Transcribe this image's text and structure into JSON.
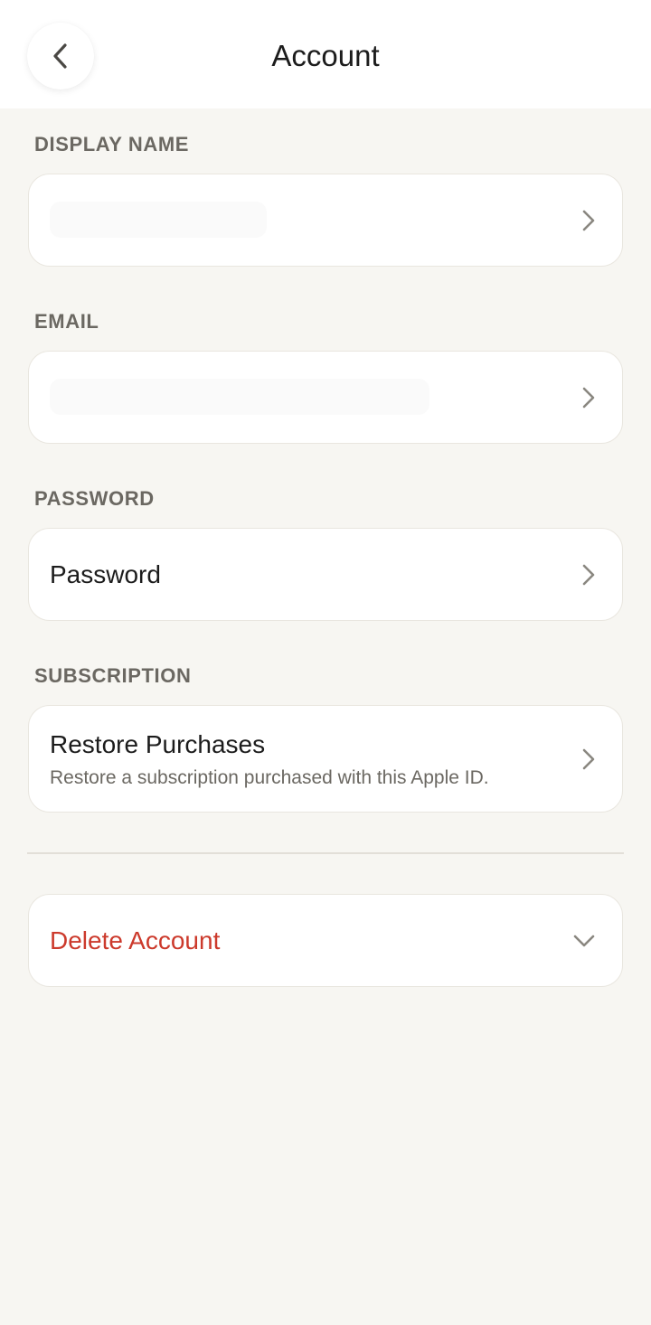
{
  "header": {
    "title": "Account",
    "back_icon": "chevron-left-icon"
  },
  "sections": {
    "display_name": {
      "label": "DISPLAY NAME",
      "value": ""
    },
    "email": {
      "label": "EMAIL",
      "value": ""
    },
    "password": {
      "label": "PASSWORD",
      "row_title": "Password"
    },
    "subscription": {
      "label": "SUBSCRIPTION",
      "row_title": "Restore Purchases",
      "row_subtitle": "Restore a subscription purchased with this Apple ID."
    }
  },
  "danger": {
    "delete_label": "Delete Account",
    "color": "#cc3a2c"
  },
  "colors": {
    "background": "#f7f6f2",
    "card": "#ffffff",
    "label": "#6b6862",
    "chevron": "#8a8780"
  }
}
